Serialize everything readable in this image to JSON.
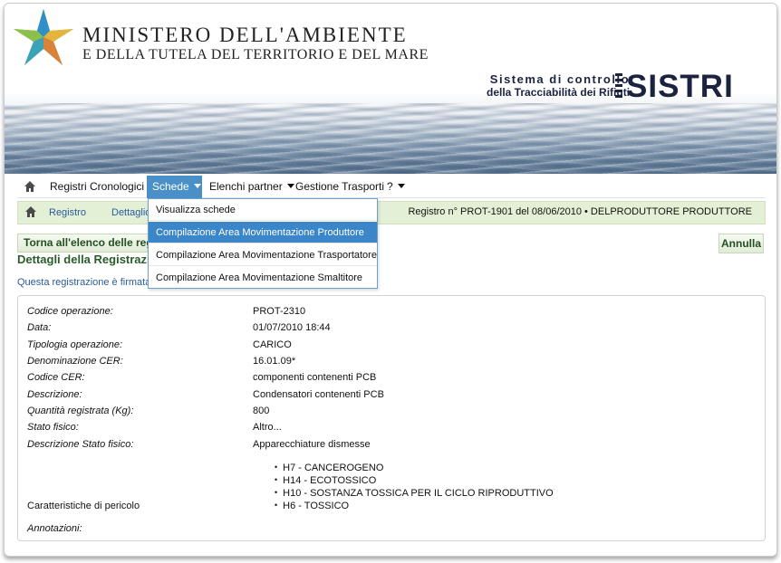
{
  "header": {
    "ministry_title": "MINISTERO DELL'AMBIENTE",
    "ministry_subtitle": "E DELLA TUTELA DEL TERRITORIO E DEL MARE",
    "sistri_line1": "Sistema di controllo",
    "sistri_line2": "della Tracciabilità dei Rifiuti",
    "sistri_logo": "SISTRI"
  },
  "menubar": {
    "items": [
      {
        "label": "Registri Cronologici"
      },
      {
        "label": "Schede"
      },
      {
        "label": "Elenchi partner"
      },
      {
        "label": "Gestione Trasporti"
      },
      {
        "label": "?"
      }
    ]
  },
  "dropdown": {
    "items": [
      {
        "label": "Visualizza schede"
      },
      {
        "label": "Compilazione Area Movimentazione Produttore"
      },
      {
        "label": "Compilazione Area Movimentazione Trasportatore"
      },
      {
        "label": "Compilazione Area Movimentazione Smaltitore"
      }
    ]
  },
  "subbar": {
    "link_registro": "Registro",
    "link_dettaglio": "Dettaglio",
    "registro_info": "Registro n° PROT-1901 del 08/06/2010  •  DELPRODUTTORE PRODUTTORE"
  },
  "actions": {
    "back_label": "Torna all'elenco delle registrazioni",
    "cancel_label": "Annulla"
  },
  "section": {
    "title": "Dettagli della Registrazione",
    "sign_note": "Questa registrazione è firmata"
  },
  "details": {
    "codice_operazione": {
      "label": "Codice operazione:",
      "value": "PROT-2310"
    },
    "data": {
      "label": "Data:",
      "value": "01/07/2010 18:44"
    },
    "tipologia": {
      "label": "Tipologia operazione:",
      "value": "CARICO"
    },
    "denominazione_cer": {
      "label": "Denominazione CER:",
      "value": "16.01.09*"
    },
    "codice_cer": {
      "label": "Codice CER:",
      "value": "componenti contenenti PCB"
    },
    "descrizione": {
      "label": "Descrizione:",
      "value": "Condensatori contenenti PCB"
    },
    "quantita": {
      "label": "Quantità registrata (Kg):",
      "value": "800"
    },
    "stato_fisico": {
      "label": "Stato fisico:",
      "value": "Altro..."
    },
    "descrizione_stato": {
      "label": "Descrizione Stato fisico:",
      "value": "Apparecchiature dismesse"
    },
    "caratteristiche": {
      "label": "Caratteristiche di pericolo"
    },
    "hazards": [
      "H7 - CANCEROGENO",
      "H14 - ECOTOSSICO",
      "H10 - SOSTANZA TOSSICA PER IL CICLO RIPRODUTTIVO",
      "H6 - TOSSICO"
    ],
    "annotazioni": {
      "label": "Annotazioni:"
    }
  }
}
